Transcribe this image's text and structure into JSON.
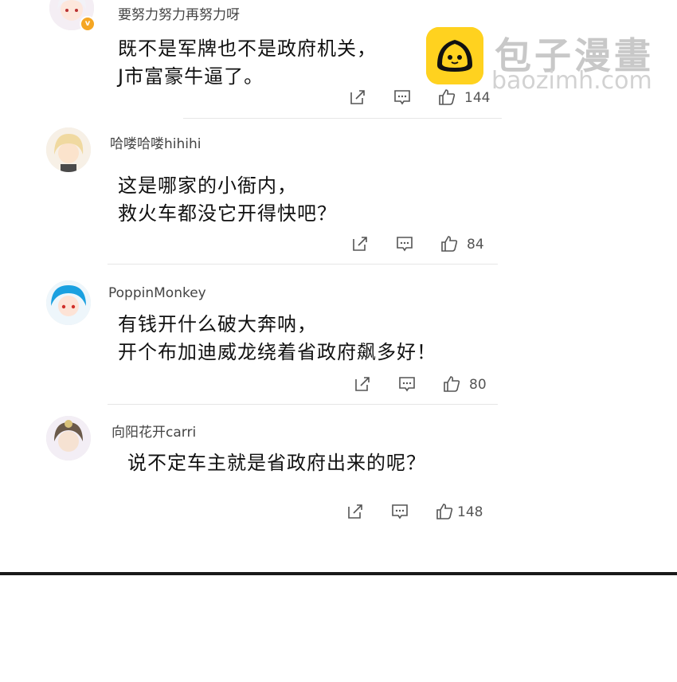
{
  "comments": [
    {
      "username": "要努力努力再努力呀",
      "lines": [
        "既不是军牌也不是政府机关，",
        "J市富豪牛逼了。"
      ],
      "likes": "144",
      "verified": true
    },
    {
      "username": "哈喽哈喽hihihi",
      "lines": [
        "这是哪家的小衙内，",
        "救火车都没它开得快吧？"
      ],
      "likes": "84",
      "verified": false
    },
    {
      "username": "PoppinMonkey",
      "lines": [
        "有钱开什么破大奔呐，",
        "开个布加迪威龙绕着省政府飙多好！"
      ],
      "likes": "80",
      "verified": false
    },
    {
      "username": "向阳花开carri",
      "lines": [
        "说不定车主就是省政府出来的呢？"
      ],
      "likes": "148",
      "verified": false
    }
  ],
  "watermark": {
    "title": "包子漫畫",
    "url": "baozimh.com"
  },
  "icons": {
    "share": "share-icon",
    "comment": "comment-icon",
    "like": "thumbs-up-icon",
    "verified": "verified-badge-icon"
  },
  "colors": {
    "watermark_logo": "#ffd21f",
    "verified_badge": "#f5a623",
    "divider": "#e6e6e6"
  }
}
